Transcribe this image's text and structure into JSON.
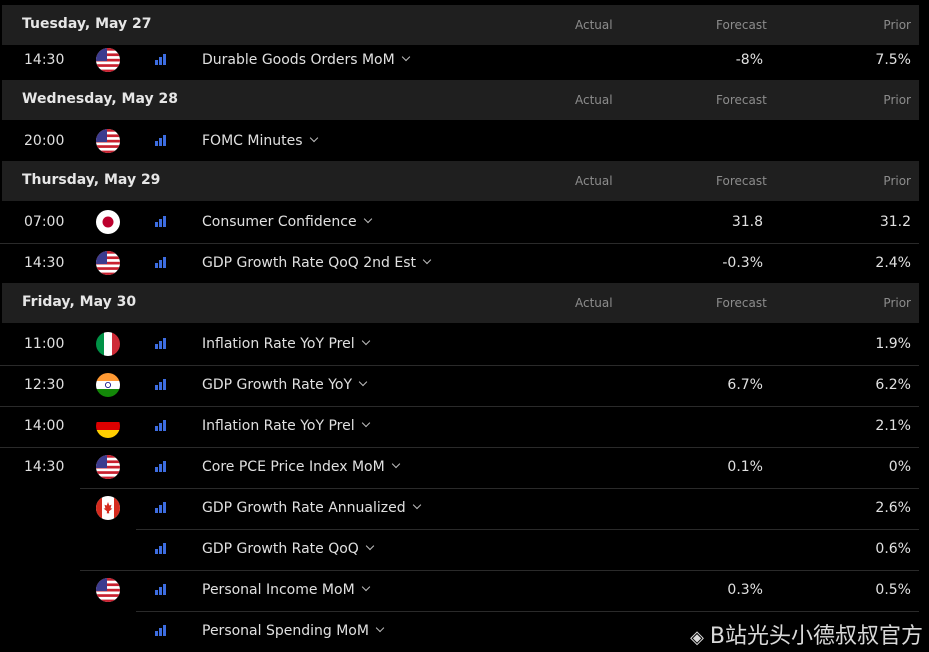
{
  "columns": {
    "actual": "Actual",
    "forecast": "Forecast",
    "prior": "Prior"
  },
  "days": [
    {
      "title": "Tuesday, May 27"
    },
    {
      "title": "Wednesday, May 28"
    },
    {
      "title": "Thursday, May 29"
    },
    {
      "title": "Friday, May 30"
    }
  ],
  "events": [
    {
      "time": "14:30",
      "flag": "us-flag-icon",
      "name": "Durable Goods Orders MoM",
      "forecast": "-8%",
      "prior": "7.5%"
    },
    {
      "time": "20:00",
      "flag": "us-flag-icon",
      "name": "FOMC Minutes",
      "forecast": "",
      "prior": ""
    },
    {
      "time": "07:00",
      "flag": "japan-flag-icon",
      "name": "Consumer Confidence",
      "forecast": "31.8",
      "prior": "31.2"
    },
    {
      "time": "14:30",
      "flag": "us-flag-icon",
      "name": "GDP Growth Rate QoQ 2nd Est",
      "forecast": "-0.3%",
      "prior": "2.4%"
    },
    {
      "time": "11:00",
      "flag": "italy-flag-icon",
      "name": "Inflation Rate YoY Prel",
      "forecast": "",
      "prior": "1.9%"
    },
    {
      "time": "12:30",
      "flag": "india-flag-icon",
      "name": "GDP Growth Rate YoY",
      "forecast": "6.7%",
      "prior": "6.2%"
    },
    {
      "time": "14:00",
      "flag": "germany-flag-icon",
      "name": "Inflation Rate YoY Prel",
      "forecast": "",
      "prior": "2.1%"
    },
    {
      "time": "14:30",
      "flag": "us-flag-icon",
      "name": "Core PCE Price Index MoM",
      "forecast": "0.1%",
      "prior": "0%"
    },
    {
      "time": "",
      "flag": "canada-flag-icon",
      "name": "GDP Growth Rate Annualized",
      "forecast": "",
      "prior": "2.6%"
    },
    {
      "time": "",
      "flag": "",
      "name": "GDP Growth Rate QoQ",
      "forecast": "",
      "prior": "0.6%"
    },
    {
      "time": "",
      "flag": "us-flag-icon",
      "name": "Personal Income MoM",
      "forecast": "0.3%",
      "prior": "0.5%"
    },
    {
      "time": "",
      "flag": "",
      "name": "Personal Spending MoM",
      "forecast": "",
      "prior": ""
    }
  ],
  "watermark": {
    "icon": "binance-icon",
    "text": "B站光头小德叔叔官方"
  },
  "colors": {
    "importance_bars": "#3d6de0",
    "header_bg": "#1f1f1f",
    "background": "#000000"
  }
}
